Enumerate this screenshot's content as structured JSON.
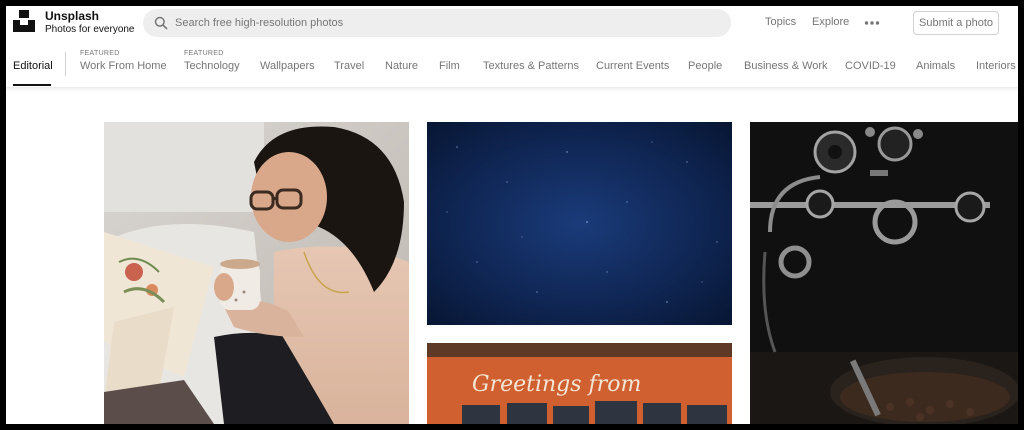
{
  "header": {
    "brand_name": "Unsplash",
    "brand_tagline": "Photos for everyone",
    "search_placeholder": "Search free high-resolution photos",
    "nav": [
      "Topics",
      "Explore"
    ],
    "more_icon": "ellipsis-icon",
    "submit_label": "Submit a photo"
  },
  "categories": {
    "active": "Editorial",
    "featured_label": "FEATURED",
    "items": [
      {
        "label": "Editorial",
        "featured": false
      },
      {
        "label": "Work From Home",
        "featured": true
      },
      {
        "label": "Technology",
        "featured": true
      },
      {
        "label": "Wallpapers",
        "featured": false
      },
      {
        "label": "Travel",
        "featured": false
      },
      {
        "label": "Nature",
        "featured": false
      },
      {
        "label": "Film",
        "featured": false
      },
      {
        "label": "Textures & Patterns",
        "featured": false
      },
      {
        "label": "Current Events",
        "featured": false
      },
      {
        "label": "People",
        "featured": false
      },
      {
        "label": "Business & Work",
        "featured": false
      },
      {
        "label": "COVID-19",
        "featured": false
      },
      {
        "label": "Animals",
        "featured": false
      },
      {
        "label": "Interiors",
        "featured": false
      }
    ]
  },
  "photos": {
    "woman_with_mug": {
      "description": "Woman in glasses holding a mug, sitting on a bed with a book"
    },
    "night_sky": {
      "description": "Dark blue starry night sky"
    },
    "coffee_roaster": {
      "description": "Black metal coffee roasting machine"
    },
    "postcard": {
      "sign_text": "Greetings from"
    }
  },
  "colors": {
    "accent_text": "#111111",
    "muted_text": "#767676",
    "search_bg": "#eeeeee"
  }
}
